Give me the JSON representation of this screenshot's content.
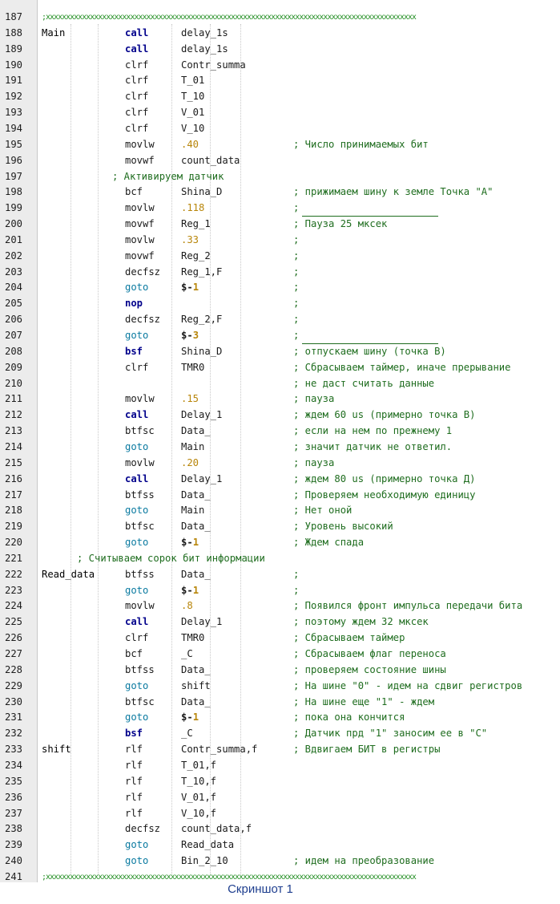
{
  "editor": {
    "section_divider": ";xxxxxxxxxxxxxxxxxxxxxxxxxxxxxxxxxxxxxxxxxxxxxxxxxxxxxxxxxxxxxxxxxxxxxxxxxxxxxxxxxxxxxxxxxxxx",
    "lines": [
      {
        "n": "187",
        "type": "divider"
      },
      {
        "n": "188",
        "label": "Main",
        "mnemonic": "call",
        "mstyle": "kw",
        "operand": "delay_1s"
      },
      {
        "n": "189",
        "mnemonic": "call",
        "mstyle": "kw",
        "operand": "delay_1s"
      },
      {
        "n": "190",
        "mnemonic": "clrf",
        "operand": "Contr_summa"
      },
      {
        "n": "191",
        "mnemonic": "clrf",
        "operand": "T_01"
      },
      {
        "n": "192",
        "mnemonic": "clrf",
        "operand": "T_10"
      },
      {
        "n": "193",
        "mnemonic": "clrf",
        "operand": "V_01"
      },
      {
        "n": "194",
        "mnemonic": "clrf",
        "operand": "V_10"
      },
      {
        "n": "195",
        "mnemonic": "movlw",
        "operand": ".40",
        "ostyle": "lit",
        "comment": "; Число принимаемых бит"
      },
      {
        "n": "196",
        "mnemonic": "movwf",
        "operand": "count_data"
      },
      {
        "n": "197",
        "section_comment": "; Активируем датчик",
        "indent": 140
      },
      {
        "n": "198",
        "mnemonic": "bcf",
        "operand": "Shina_D",
        "comment": "; прижимаем шину к земле Точка \"А\""
      },
      {
        "n": "199",
        "mnemonic": "movlw",
        "operand": ".118",
        "ostyle": "lit",
        "comment": ";",
        "underline": true
      },
      {
        "n": "200",
        "mnemonic": "movwf",
        "operand": "Reg_1",
        "comment": "; Пауза 25 мксек"
      },
      {
        "n": "201",
        "mnemonic": "movlw",
        "operand": ".33",
        "ostyle": "lit",
        "comment": ";"
      },
      {
        "n": "202",
        "mnemonic": "movwf",
        "operand": "Reg_2",
        "comment": ";"
      },
      {
        "n": "203",
        "mnemonic": "decfsz",
        "operand": "Reg_1,F",
        "comment": ";"
      },
      {
        "n": "204",
        "mnemonic": "goto",
        "mstyle": "goto",
        "operand": "$-",
        "rel": "1",
        "comment": ";"
      },
      {
        "n": "205",
        "mnemonic": "nop",
        "mstyle": "kw",
        "comment": ";"
      },
      {
        "n": "206",
        "mnemonic": "decfsz",
        "operand": "Reg_2,F",
        "comment": ";"
      },
      {
        "n": "207",
        "mnemonic": "goto",
        "mstyle": "goto",
        "operand": "$-",
        "rel": "3",
        "comment": ";",
        "underline": true
      },
      {
        "n": "208",
        "mnemonic": "bsf",
        "mstyle": "kw",
        "operand": "Shina_D",
        "comment": "; отпускаем шину (точка В)"
      },
      {
        "n": "209",
        "mnemonic": "clrf",
        "operand": "TMR0",
        "comment": "; Сбрасываем таймер, иначе прерывание"
      },
      {
        "n": "210",
        "comment": "; не даст считать данные"
      },
      {
        "n": "211",
        "mnemonic": "movlw",
        "operand": ".15",
        "ostyle": "lit",
        "comment": "; пауза"
      },
      {
        "n": "212",
        "mnemonic": "call",
        "mstyle": "kw",
        "operand": "Delay_1",
        "comment": "; ждем 60 us (примерно точка В)"
      },
      {
        "n": "213",
        "mnemonic": "btfsc",
        "operand": "Data_",
        "comment": "; если на нем по прежнему 1"
      },
      {
        "n": "214",
        "mnemonic": "goto",
        "mstyle": "goto",
        "operand": "Main",
        "comment": "; значит датчик не ответил."
      },
      {
        "n": "215",
        "mnemonic": "movlw",
        "operand": ".20",
        "ostyle": "lit",
        "comment": "; пауза"
      },
      {
        "n": "216",
        "mnemonic": "call",
        "mstyle": "kw",
        "operand": "Delay_1",
        "comment": "; ждем 80 us (примерно точка Д)"
      },
      {
        "n": "217",
        "mnemonic": "btfss",
        "operand": "Data_",
        "comment": "; Проверяем необходимую единицу"
      },
      {
        "n": "218",
        "mnemonic": "goto",
        "mstyle": "goto",
        "operand": "Main",
        "comment": "; Нет оной"
      },
      {
        "n": "219",
        "mnemonic": "btfsc",
        "operand": "Data_",
        "comment": "; Уровень высокий"
      },
      {
        "n": "220",
        "mnemonic": "goto",
        "mstyle": "goto",
        "operand": "$-",
        "rel": "1",
        "comment": "; Ждем спада"
      },
      {
        "n": "221",
        "section_comment": "; Считываем сорок бит информации",
        "indent": 96
      },
      {
        "n": "222",
        "label": "Read_data",
        "mnemonic": "btfss",
        "operand": "Data_",
        "comment": ";"
      },
      {
        "n": "223",
        "mnemonic": "goto",
        "mstyle": "goto",
        "operand": "$-",
        "rel": "1",
        "comment": ";"
      },
      {
        "n": "224",
        "mnemonic": "movlw",
        "operand": ".8",
        "ostyle": "lit",
        "comment": "; Появился фронт импульса передачи бита"
      },
      {
        "n": "225",
        "mnemonic": "call",
        "mstyle": "kw",
        "operand": "Delay_1",
        "comment": "; поэтому ждем 32 мксек"
      },
      {
        "n": "226",
        "mnemonic": "clrf",
        "operand": "TMR0",
        "comment": "; Сбрасываем таймер"
      },
      {
        "n": "227",
        "mnemonic": "bcf",
        "operand": "_C",
        "comment": "; Сбрасываем флаг переноса"
      },
      {
        "n": "228",
        "mnemonic": "btfss",
        "operand": "Data_",
        "comment": "; проверяем состояние шины"
      },
      {
        "n": "229",
        "mnemonic": "goto",
        "mstyle": "goto",
        "operand": "shift",
        "comment": "; На шине \"0\" - идем на сдвиг регистров"
      },
      {
        "n": "230",
        "mnemonic": "btfsc",
        "operand": "Data_",
        "comment": "; На шине еще \"1\" - ждем"
      },
      {
        "n": "231",
        "mnemonic": "goto",
        "mstyle": "goto",
        "operand": "$-",
        "rel": "1",
        "comment": "; пока она кончится"
      },
      {
        "n": "232",
        "mnemonic": "bsf",
        "mstyle": "kw",
        "operand": "_C",
        "comment": "; Датчик прд \"1\" заносим ее в \"С\""
      },
      {
        "n": "233",
        "label": "shift",
        "mnemonic": "rlf",
        "operand": "Contr_summa,f",
        "comment": "; Вдвигаем БИТ в регистры"
      },
      {
        "n": "234",
        "mnemonic": "rlf",
        "operand": "T_01,f"
      },
      {
        "n": "235",
        "mnemonic": "rlf",
        "operand": "T_10,f"
      },
      {
        "n": "236",
        "mnemonic": "rlf",
        "operand": "V_01,f"
      },
      {
        "n": "237",
        "mnemonic": "rlf",
        "operand": "V_10,f"
      },
      {
        "n": "238",
        "mnemonic": "decfsz",
        "operand": "count_data,f"
      },
      {
        "n": "239",
        "mnemonic": "goto",
        "mstyle": "goto",
        "operand": "Read_data"
      },
      {
        "n": "240",
        "mnemonic": "goto",
        "mstyle": "goto",
        "operand": "Bin_2_10",
        "comment": "; идем на преобразование"
      },
      {
        "n": "241",
        "type": "divider"
      }
    ]
  },
  "caption": "Скриншот 1"
}
